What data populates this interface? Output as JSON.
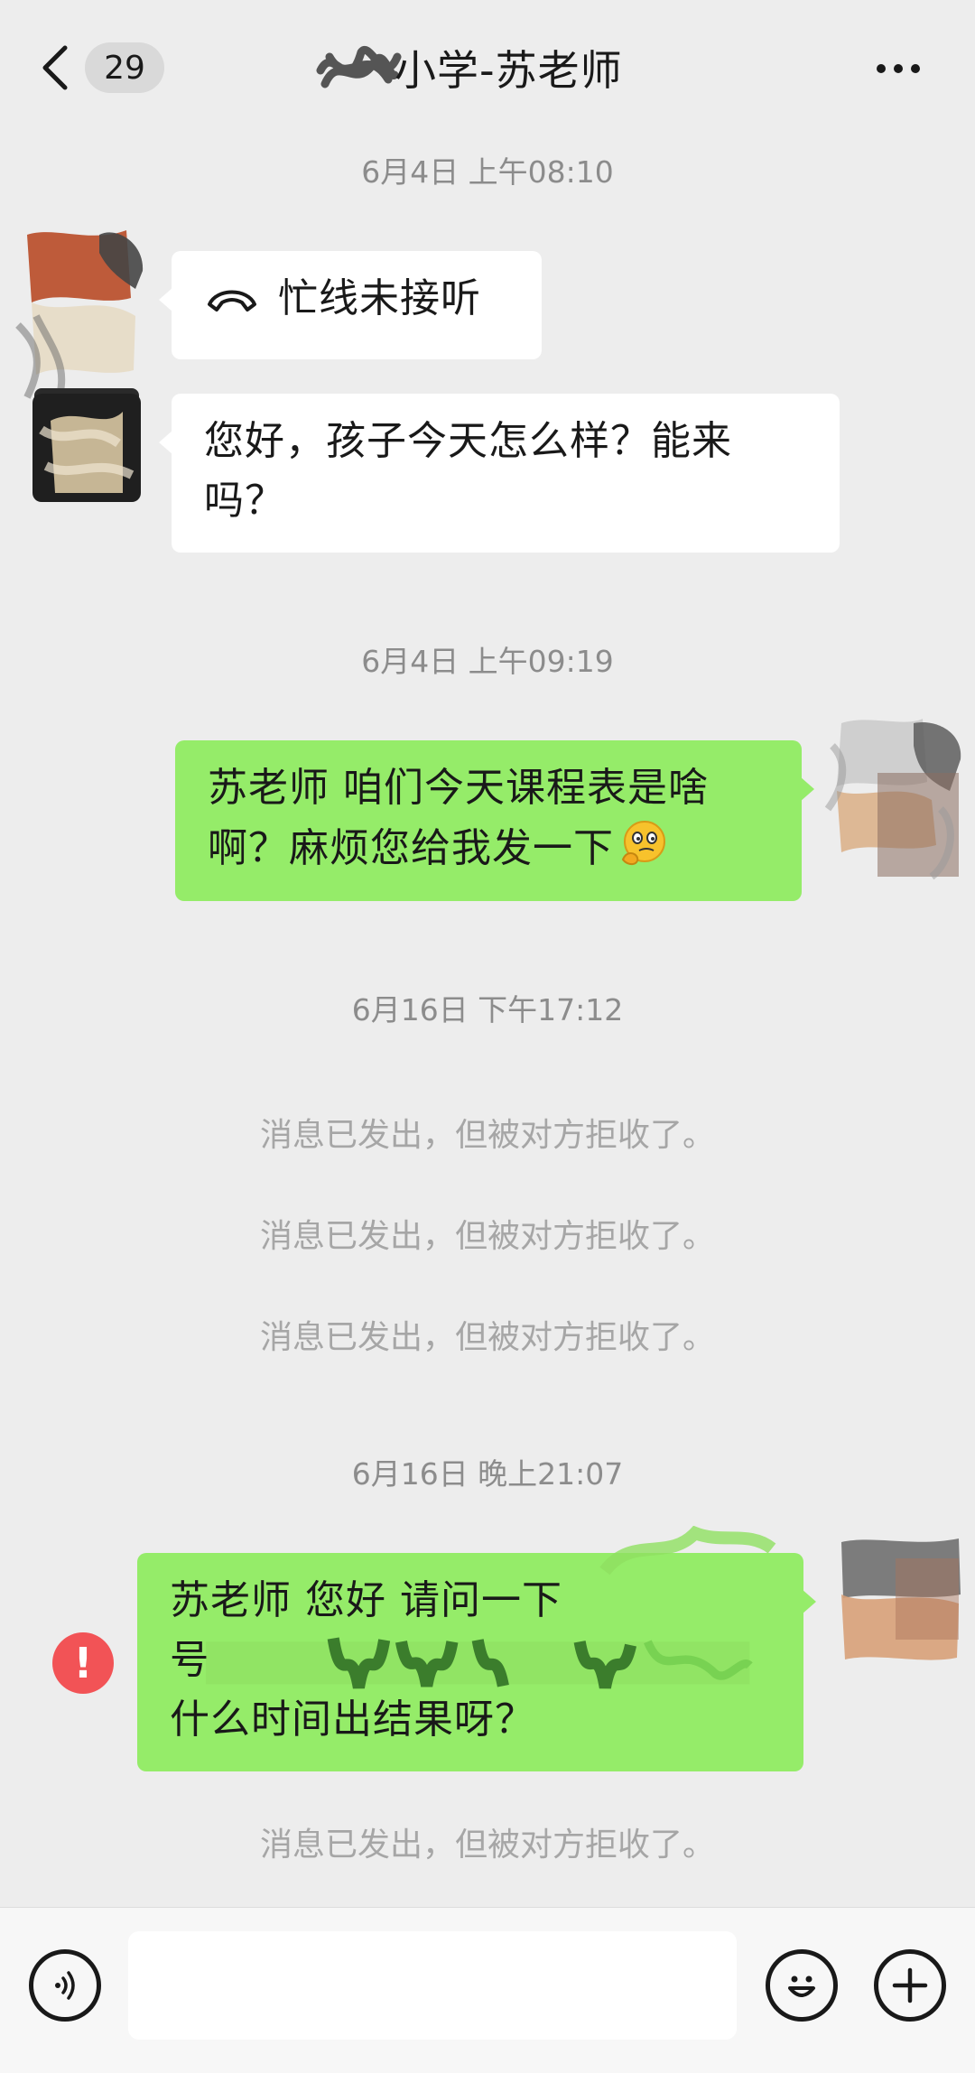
{
  "header": {
    "unread_count": "29",
    "title": "小学-苏老师"
  },
  "messages": {
    "ts1": "6月4日 上午08:10",
    "call_text": "忙线未接听",
    "teacher_line1": "您好，孩子今天怎么样？能来",
    "teacher_line2": "吗？",
    "ts2": "6月4日 上午09:19",
    "me1_line1": "苏老师 咱们今天课程表是啥",
    "me1_line2": "啊？麻烦您给我发一下",
    "ts3": "6月16日 下午17:12",
    "rejected1": "消息已发出，但被对方拒收了。",
    "rejected2": "消息已发出，但被对方拒收了。",
    "rejected3": "消息已发出，但被对方拒收了。",
    "ts4": "6月16日 晚上21:07",
    "me2_line1": "苏老师 您好 请问一下",
    "me2_line2": "号",
    "me2_line3": "什么时间出结果呀？",
    "rejected4": "消息已发出，但被对方拒收了。",
    "failed_mark": "!"
  },
  "colors": {
    "background": "#ededed",
    "my_bubble": "#95ec69",
    "their_bubble": "#ffffff",
    "error_red": "#f25356"
  },
  "icons": {
    "back": "chevron-left-icon",
    "more": "more-dots-icon",
    "call": "phone-hangup-icon",
    "voice": "voice-icon",
    "emoji": "emoji-icon",
    "plus": "plus-icon"
  }
}
